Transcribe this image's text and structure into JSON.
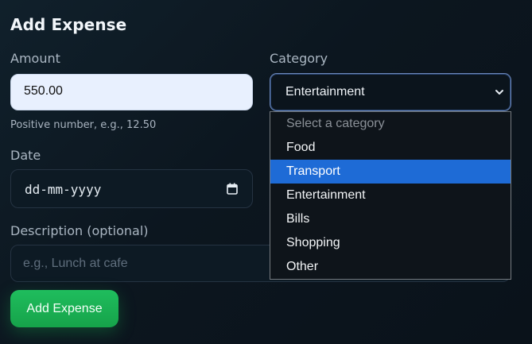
{
  "form": {
    "title": "Add Expense",
    "amount": {
      "label": "Amount",
      "value": "550.00",
      "hint": "Positive number, e.g., 12.50"
    },
    "category": {
      "label": "Category",
      "selected": "Entertainment",
      "options": [
        "Select a category",
        "Food",
        "Transport",
        "Entertainment",
        "Bills",
        "Shopping",
        "Other"
      ],
      "highlighted_option": "Transport"
    },
    "date": {
      "label": "Date",
      "placeholder": "dd-mm-yyyy",
      "icon": "calendar-icon"
    },
    "description": {
      "label": "Description (optional)",
      "placeholder": "e.g., Lunch at cafe"
    },
    "submit_label": "Add Expense"
  },
  "colors": {
    "accent_green": "#16a34a",
    "highlight_blue": "#1e6bd6",
    "amount_field_bg": "#e8f0fe"
  }
}
